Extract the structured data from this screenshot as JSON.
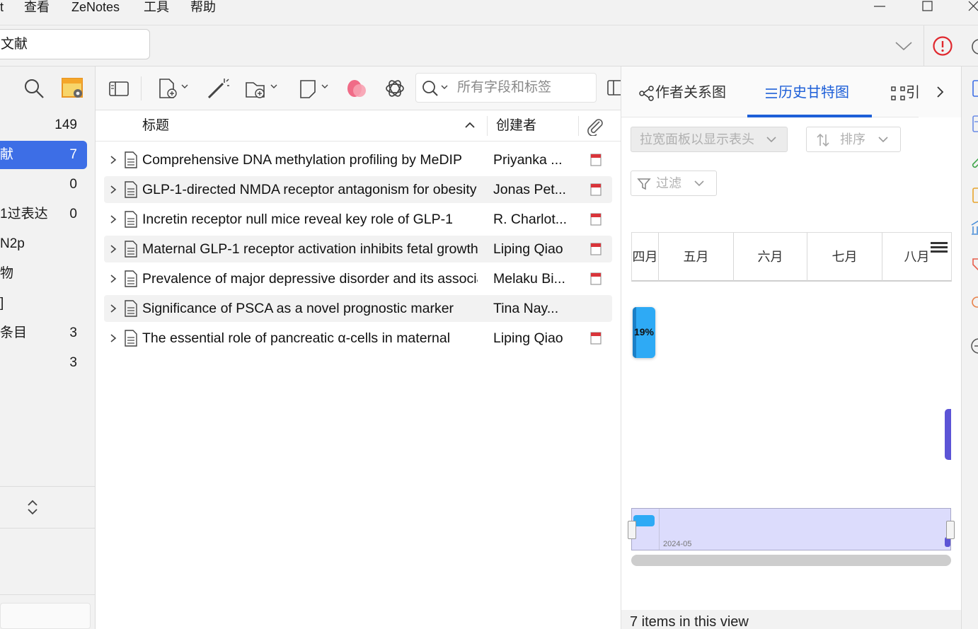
{
  "menu": {
    "partial_first": "t",
    "view": "查看",
    "zenotes": "ZeNotes",
    "tools": "工具",
    "help": "帮助"
  },
  "tab": {
    "label": "文献"
  },
  "left": {
    "items": [
      {
        "label": "",
        "count": "149"
      },
      {
        "label": "献",
        "count": "7"
      },
      {
        "label": "",
        "count": "0"
      },
      {
        "label": "1过表达",
        "count": "0"
      },
      {
        "label": "N2p",
        "count": ""
      },
      {
        "label": "物",
        "count": ""
      },
      {
        "label": "]",
        "count": ""
      },
      {
        "label": "条目",
        "count": "3"
      },
      {
        "label": "",
        "count": "3"
      }
    ]
  },
  "search": {
    "placeholder": "所有字段和标签"
  },
  "columns": {
    "title": "标题",
    "creator": "创建者"
  },
  "rows": [
    {
      "title": "Comprehensive DNA methylation profiling by MeDIP",
      "creator": "Priyanka ...",
      "pdf": true
    },
    {
      "title": "GLP-1-directed NMDA receptor antagonism for obesity",
      "creator": "Jonas Pet...",
      "pdf": true
    },
    {
      "title": "Incretin receptor null mice reveal key role of GLP-1",
      "creator": "R. Charlot...",
      "pdf": true
    },
    {
      "title": "Maternal GLP-1 receptor activation inhibits fetal growth",
      "creator": "Liping Qiao",
      "pdf": true
    },
    {
      "title": "Prevalence of major depressive disorder and its associated",
      "creator": "Melaku Bi...",
      "pdf": true
    },
    {
      "title": "Significance of PSCA as a novel prognostic marker",
      "creator": "Tina Nay...",
      "pdf": false
    },
    {
      "title": "The essential role of pancreatic α-cells in maternal",
      "creator": "Liping Qiao",
      "pdf": true
    }
  ],
  "right": {
    "tabs": {
      "author_graph": "作者关系图",
      "history_gantt": "历史甘特图",
      "partial": "引"
    },
    "widen_hint": "拉宽面板以显示表头",
    "sort": "排序",
    "filter": "过滤",
    "months": [
      "四月",
      "五月",
      "六月",
      "七月",
      "八月"
    ],
    "bar_percent": "19%",
    "nav_label": "2024-05",
    "status": "7 items in this view"
  },
  "colors": {
    "accent": "#3d6ee6",
    "tab_underline": "#1d5fd8",
    "gantt_bar": "#2eaaf5",
    "gantt_bar2": "#5c54d6",
    "alert": "#e0282e"
  }
}
